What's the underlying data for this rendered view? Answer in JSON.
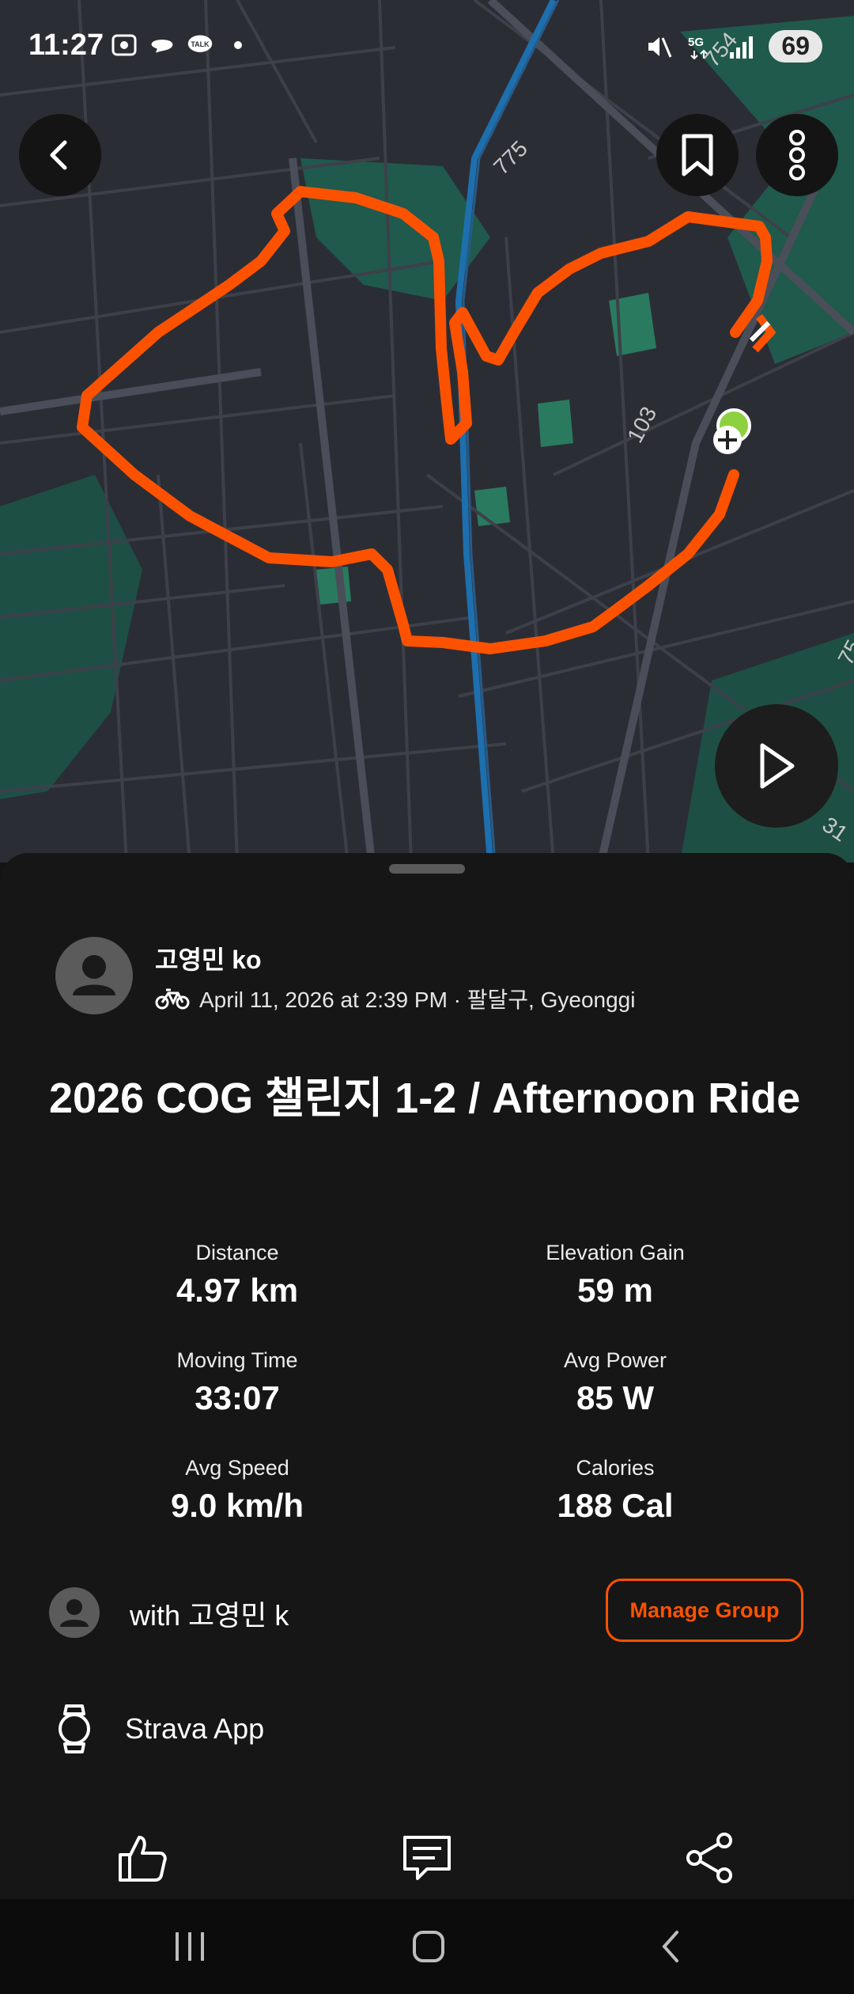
{
  "status_bar": {
    "time": "11:27",
    "battery": "69",
    "left_icons": [
      "screenshot-icon",
      "chat-bubble-icon",
      "talk-icon",
      "dot-icon"
    ],
    "right_icons": [
      "mute-icon",
      "5g-icon",
      "signal-icon"
    ]
  },
  "map": {
    "road_labels": [
      "775",
      "103",
      "75",
      "31",
      "754"
    ],
    "route_color": "#fc5200",
    "start_color": "#8ed140"
  },
  "activity": {
    "athlete_name": "고영민 ko",
    "date_location": "April 11, 2026 at 2:39 PM · 팔달구, Gyeonggi",
    "sport_icon": "bike-icon",
    "title": "2026 COG 챌린지 1-2 / Afternoon Ride",
    "stats": [
      {
        "label": "Distance",
        "value": "4.97 km"
      },
      {
        "label": "Elevation Gain",
        "value": "59 m"
      },
      {
        "label": "Moving Time",
        "value": "33:07"
      },
      {
        "label": "Avg Power",
        "value": "85 W"
      },
      {
        "label": "Avg Speed",
        "value": "9.0 km/h"
      },
      {
        "label": "Calories",
        "value": "188 Cal"
      }
    ],
    "group_text": "with 고영민 k",
    "manage_group_label": "Manage Group",
    "device": "Strava App"
  },
  "colors": {
    "accent": "#fc5200",
    "background": "#161616"
  }
}
